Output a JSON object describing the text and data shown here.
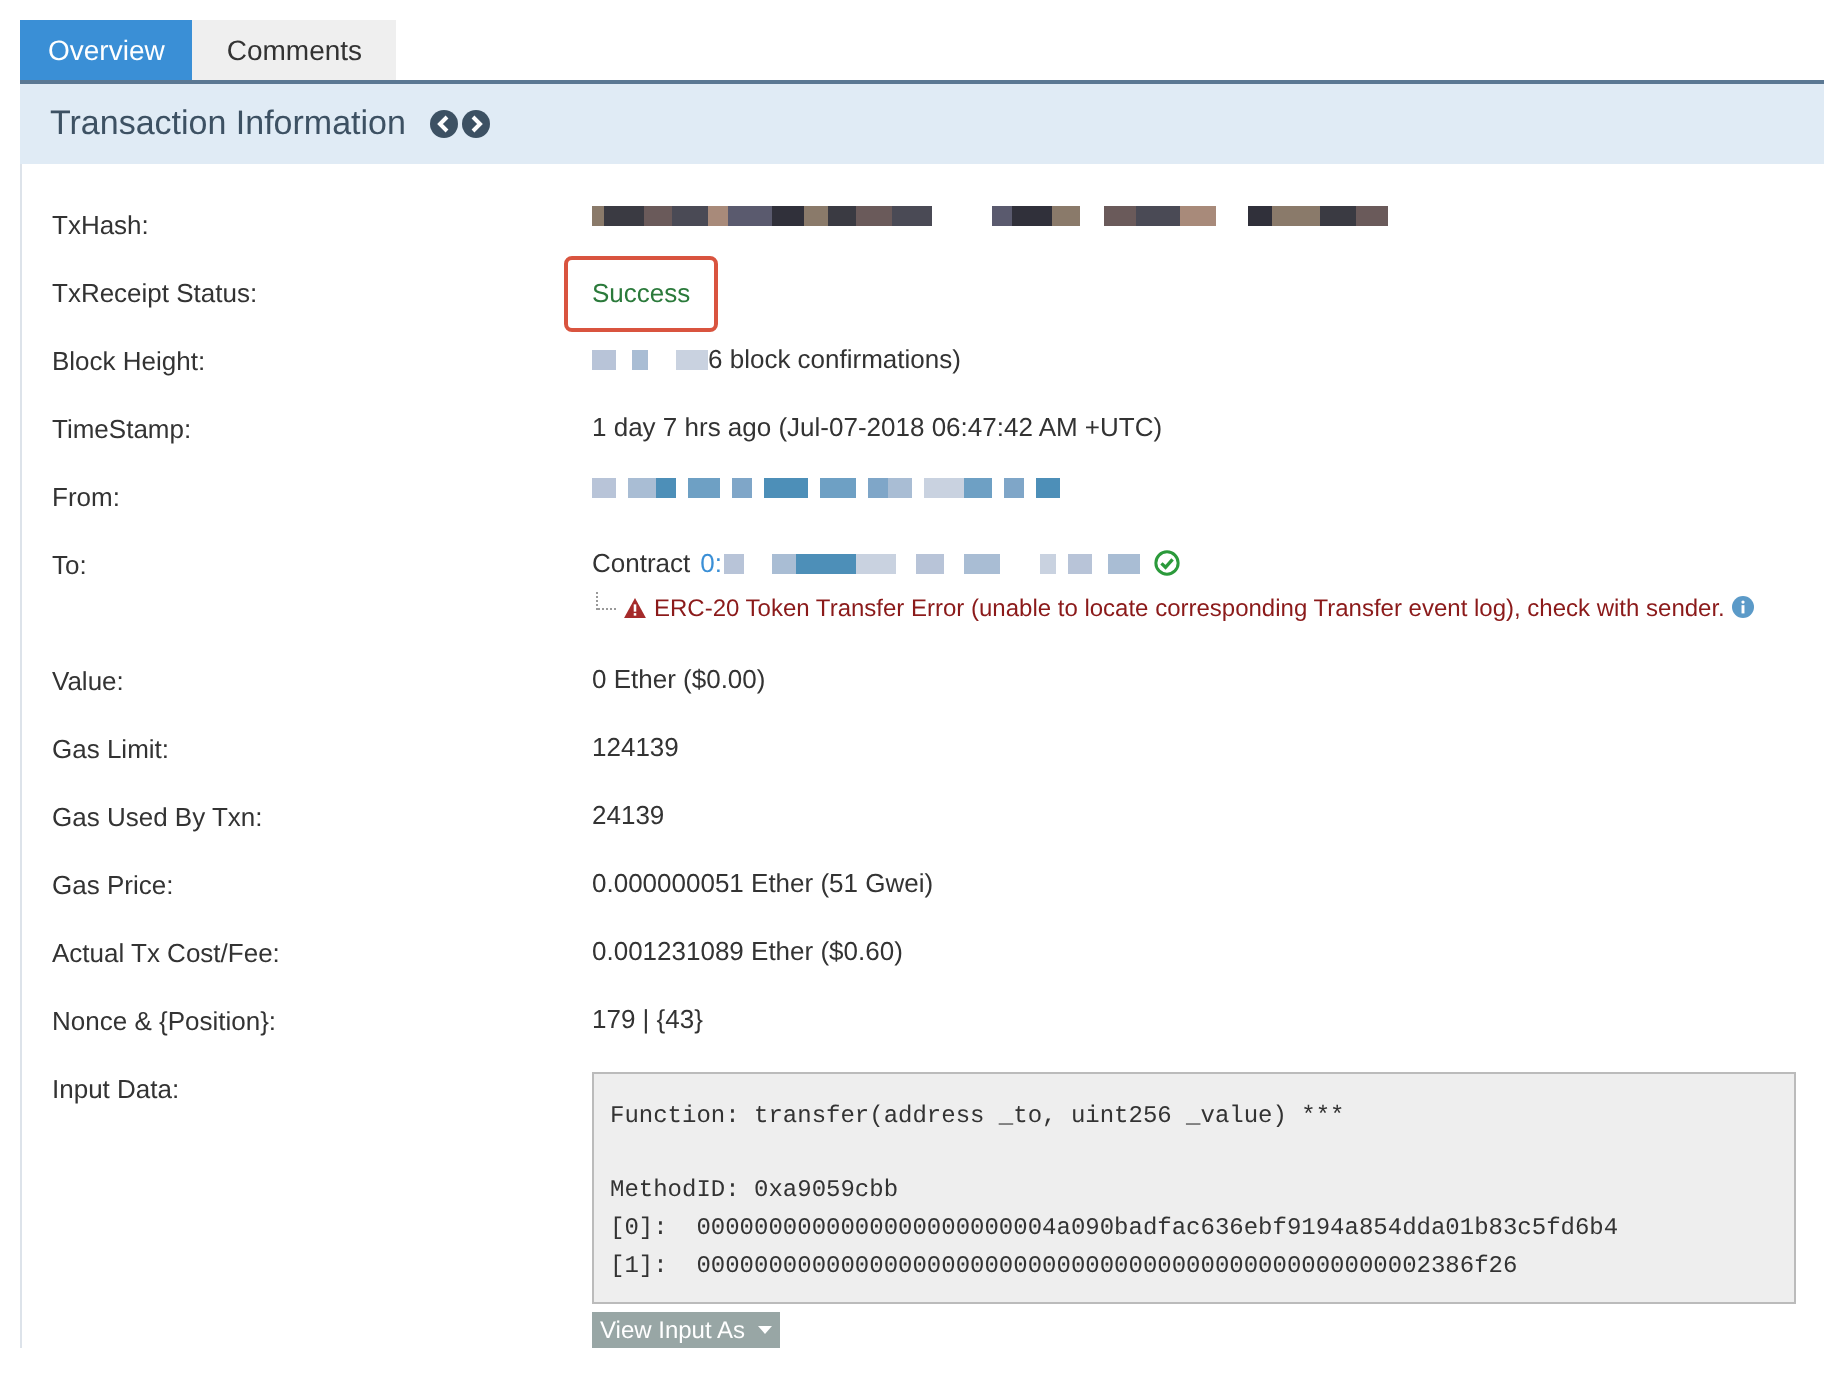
{
  "tabs": [
    {
      "label": "Overview",
      "selected": true
    },
    {
      "label": "Comments",
      "selected": false
    }
  ],
  "panel": {
    "title": "Transaction Information"
  },
  "rows": [
    {
      "label": "TxHash:",
      "kind": "hash"
    },
    {
      "label": "TxReceipt Status:",
      "kind": "status",
      "value": "Success",
      "highlighted": true
    },
    {
      "label": "Block Height:",
      "kind": "block",
      "value": "6 block confirmations)"
    },
    {
      "label": "TimeStamp:",
      "kind": "text",
      "value": "1 day 7 hrs ago (Jul-07-2018 06:47:42 AM +UTC)"
    },
    {
      "label": "From:",
      "kind": "address"
    },
    {
      "label": "To:",
      "kind": "contract",
      "prefix": "Contract",
      "address_start": "0:",
      "verified": true,
      "warning": "ERC-20 Token Transfer Error (unable to locate corresponding Transfer event log), check with sender."
    },
    {
      "label": "Value:",
      "kind": "text",
      "value": "0 Ether ($0.00)"
    },
    {
      "label": "Gas Limit:",
      "kind": "text",
      "value": "124139"
    },
    {
      "label": "Gas Used By Txn:",
      "kind": "text",
      "value": "24139"
    },
    {
      "label": "Gas Price:",
      "kind": "text",
      "value": "0.000000051 Ether (51 Gwei)"
    },
    {
      "label": "Actual Tx Cost/Fee:",
      "kind": "text",
      "value": "0.001231089 Ether ($0.60)"
    },
    {
      "label": "Nonce & {Position}:",
      "kind": "text",
      "value": "179 | {43}"
    },
    {
      "label": "Input Data:",
      "kind": "input",
      "sections": [
        [
          "Function: transfer(address _to, uint256 _value) ***"
        ],
        [
          "MethodID: 0xa9059cbb",
          "[0]:  0000000000000000000000004a090badfac636ebf9194a854dda01b83c5fd6b4",
          "[1]:  000000000000000000000000000000000000000000000000002386f26"
        ]
      ],
      "button": "View Input As"
    }
  ]
}
